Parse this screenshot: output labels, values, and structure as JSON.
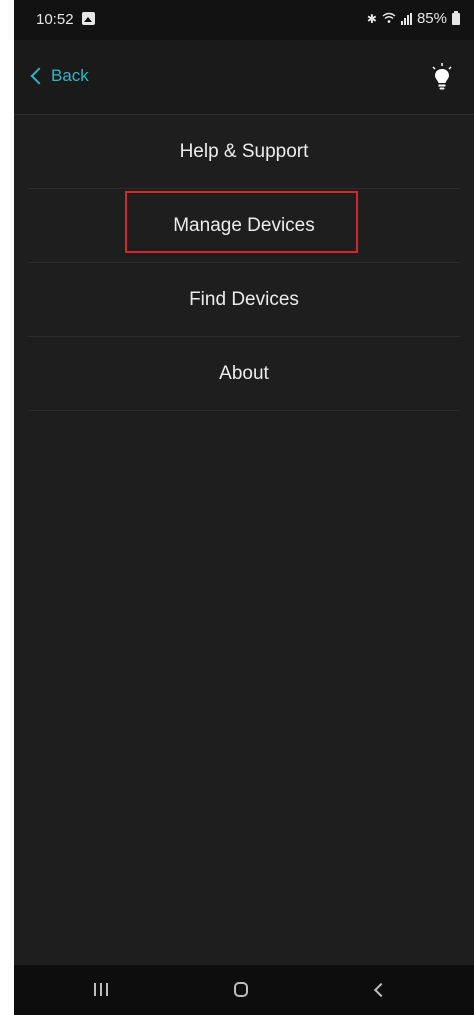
{
  "status_bar": {
    "time": "10:52",
    "battery": "85%"
  },
  "header": {
    "back_label": "Back",
    "accent_color": "#2ab7c4"
  },
  "menu": {
    "items": [
      {
        "label": "Help & Support"
      },
      {
        "label": "Manage Devices"
      },
      {
        "label": "Find Devices"
      },
      {
        "label": "About"
      }
    ],
    "highlight_color": "#d9232d"
  },
  "icons": {
    "status": [
      "gallery-icon",
      "bluetooth-icon",
      "wifi-icon",
      "signal-icon",
      "battery-icon"
    ],
    "header": [
      "chevron-left-icon",
      "lightbulb-icon"
    ],
    "nav": [
      "recents-icon",
      "home-icon",
      "back-icon"
    ]
  }
}
